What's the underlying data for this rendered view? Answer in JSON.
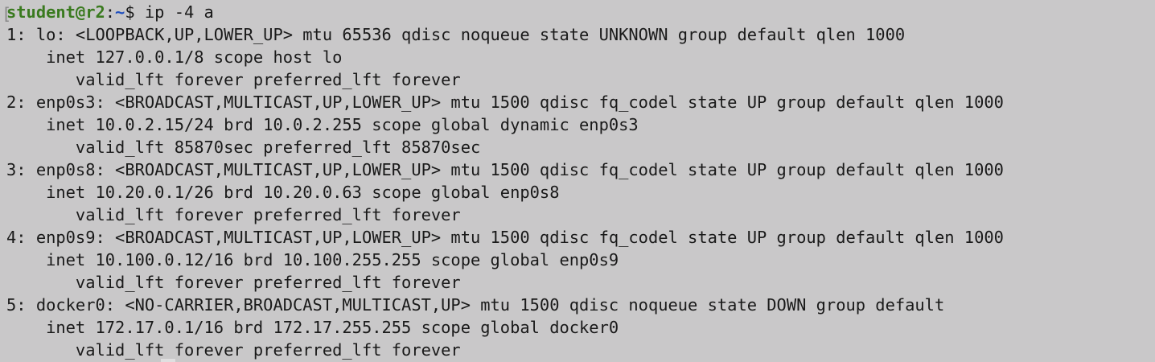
{
  "prompt": {
    "user_host": "student@r2",
    "separator": ":",
    "path": "~",
    "symbol": "$ ",
    "command": "ip -4 a"
  },
  "output_lines": [
    "1: lo: <LOOPBACK,UP,LOWER_UP> mtu 65536 qdisc noqueue state UNKNOWN group default qlen 1000",
    "    inet 127.0.0.1/8 scope host lo",
    "       valid_lft forever preferred_lft forever",
    "2: enp0s3: <BROADCAST,MULTICAST,UP,LOWER_UP> mtu 1500 qdisc fq_codel state UP group default qlen 1000",
    "    inet 10.0.2.15/24 brd 10.0.2.255 scope global dynamic enp0s3",
    "       valid_lft 85870sec preferred_lft 85870sec",
    "3: enp0s8: <BROADCAST,MULTICAST,UP,LOWER_UP> mtu 1500 qdisc fq_codel state UP group default qlen 1000",
    "    inet 10.20.0.1/26 brd 10.20.0.63 scope global enp0s8",
    "       valid_lft forever preferred_lft forever",
    "4: enp0s9: <BROADCAST,MULTICAST,UP,LOWER_UP> mtu 1500 qdisc fq_codel state UP group default qlen 1000",
    "    inet 10.100.0.12/16 brd 10.100.255.255 scope global enp0s9",
    "       valid_lft forever preferred_lft forever",
    "5: docker0: <NO-CARRIER,BROADCAST,MULTICAST,UP> mtu 1500 qdisc noqueue state DOWN group default",
    "    inet 172.17.0.1/16 brd 172.17.255.255 scope global docker0",
    "       valid_lft forever preferred_lft forever"
  ],
  "colors": {
    "background": "#c9c8c9",
    "text": "#1a1a1a",
    "prompt_user": "#3a7a1f",
    "prompt_path": "#1f4fbf"
  }
}
